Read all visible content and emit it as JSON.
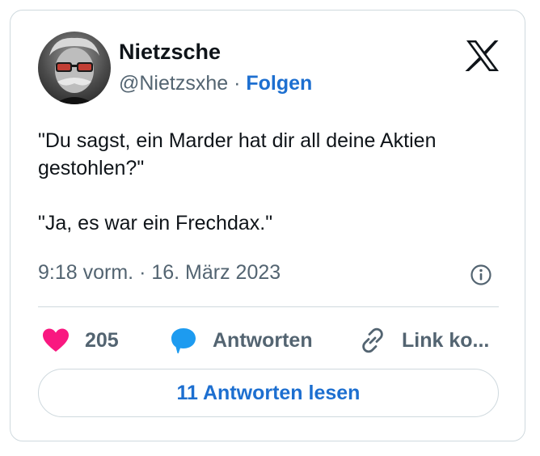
{
  "author": {
    "name": "Nietzsche",
    "handle": "@Nietzsxhe",
    "separator": "·",
    "follow_label": "Folgen"
  },
  "tweet": {
    "text": "\"Du sagst, ein Marder hat dir all deine Aktien gestohlen?\"\n\n\"Ja, es war ein Frechdax.\"",
    "time": "9:18 vorm.",
    "date_separator": "·",
    "date": "16. März 2023"
  },
  "actions": {
    "like_count": "205",
    "reply_label": "Antworten",
    "copy_link_label": "Link ko..."
  },
  "read_replies_label": "11 Antworten lesen",
  "icons": {
    "logo": "x-logo-icon",
    "info": "info-icon",
    "like": "heart-icon",
    "reply": "speech-bubble-icon",
    "copy_link": "link-icon"
  },
  "colors": {
    "accent": "#1d6fd0",
    "heart": "#f91880",
    "reply_bubble": "#1d9bf0",
    "muted_text": "#536471",
    "border": "#cfd9de"
  }
}
